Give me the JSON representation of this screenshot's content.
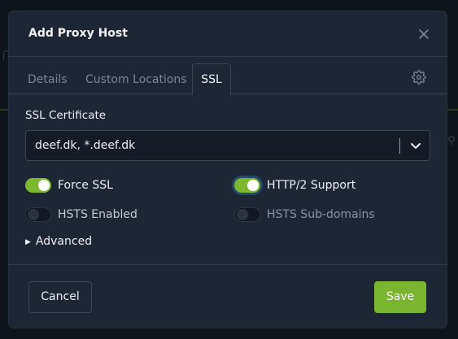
{
  "modal": {
    "title": "Add Proxy Host",
    "close_icon": "close-icon"
  },
  "tabs": [
    {
      "label": "Details",
      "active": false
    },
    {
      "label": "Custom Locations",
      "active": false
    },
    {
      "label": "SSL",
      "active": true
    }
  ],
  "settings_icon": "gear-icon",
  "ssl": {
    "certificate_label": "SSL Certificate",
    "certificate_value": "deef.dk, *.deef.dk",
    "toggles": [
      {
        "label": "Force SSL",
        "on": true
      },
      {
        "label": "HTTP/2 Support",
        "on": true
      },
      {
        "label": "HSTS Enabled",
        "on": false
      },
      {
        "label": "HSTS Sub-domains",
        "on": false
      }
    ],
    "advanced_label": "Advanced"
  },
  "footer": {
    "cancel_label": "Cancel",
    "save_label": "Save"
  },
  "colors": {
    "accent": "#7ab52f",
    "modal_bg": "#1d2634",
    "page_bg": "#10141c"
  }
}
